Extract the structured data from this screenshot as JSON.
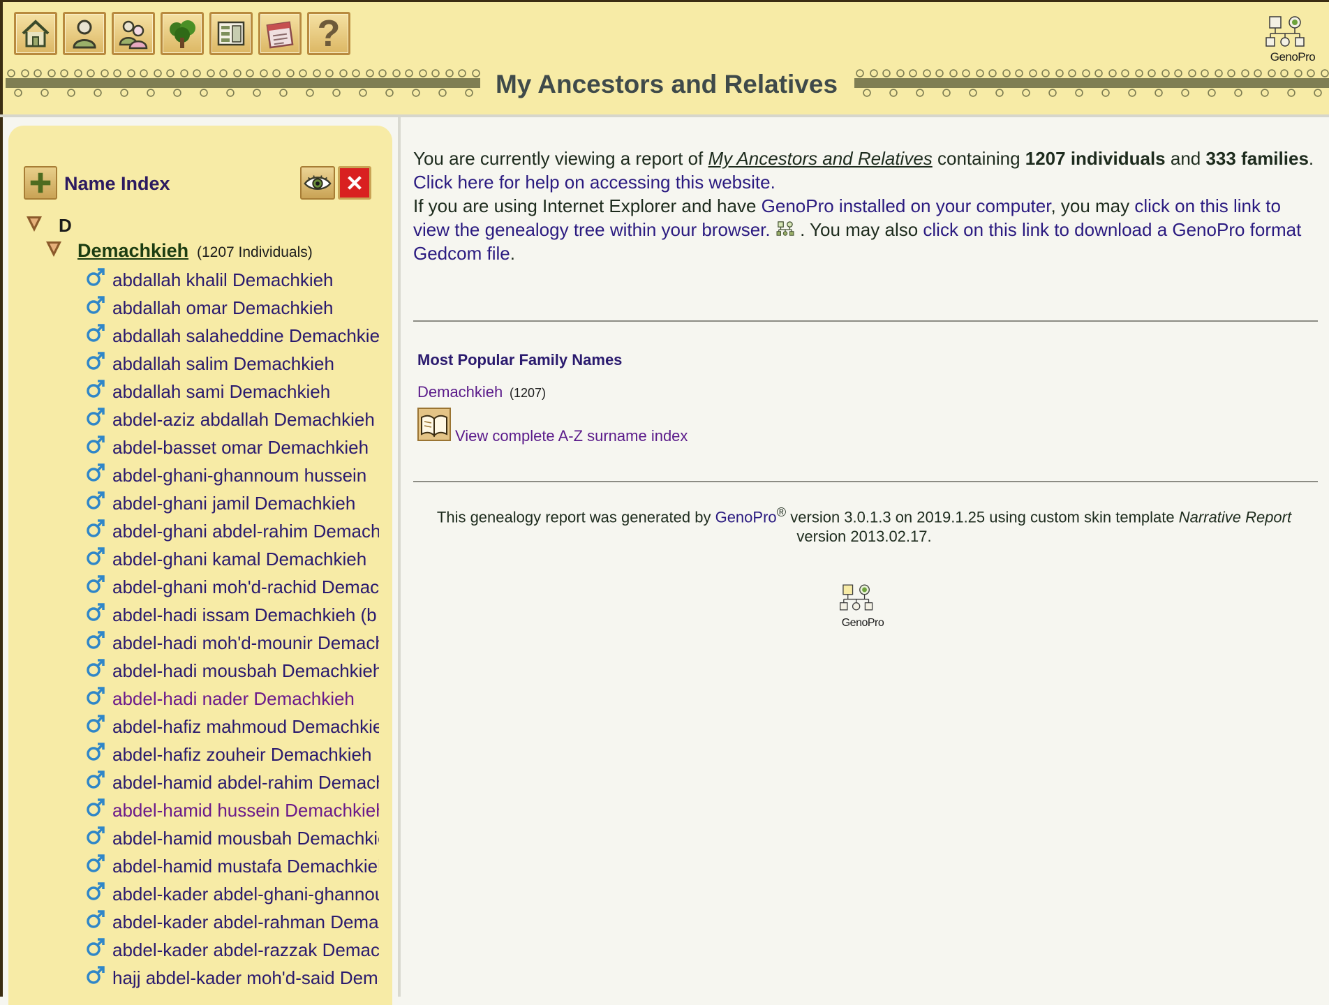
{
  "toolbar": {
    "buttons": [
      {
        "name": "home-button",
        "icon": "house-icon"
      },
      {
        "name": "individuals-button",
        "icon": "person-icon"
      },
      {
        "name": "families-button",
        "icon": "couple-icon"
      },
      {
        "name": "tree-button",
        "icon": "tree-icon"
      },
      {
        "name": "chart-button",
        "icon": "chart-icon"
      },
      {
        "name": "calendar-button",
        "icon": "calendar-icon"
      },
      {
        "name": "help-button",
        "icon": "question-icon",
        "label": "?"
      }
    ]
  },
  "header": {
    "title": "My Ancestors and Relatives",
    "logo_text": "GenoPro"
  },
  "sidebar": {
    "title": "Name Index",
    "letter": "D",
    "surname": "Demachkieh",
    "surname_count": "(1207 Individuals)",
    "people": [
      "abdallah khalil Demachkieh",
      "abdallah omar Demachkieh",
      "abdallah salaheddine Demachkieh",
      "abdallah salim Demachkieh",
      "abdallah sami Demachkieh",
      "abdel-aziz abdallah Demachkieh",
      "abdel-basset omar Demachkieh",
      "abdel-ghani-ghannoum hussein",
      "abdel-ghani  jamil Demachkieh",
      "abdel-ghani abdel-rahim Demachkieh",
      "abdel-ghani kamal Demachkieh",
      "abdel-ghani moh'd-rachid Demachkieh",
      "abdel-hadi issam Demachkieh (b",
      "abdel-hadi moh'd-mounir Demachkieh",
      "abdel-hadi mousbah Demachkieh",
      "abdel-hadi nader Demachkieh",
      "abdel-hafiz mahmoud Demachkieh",
      "abdel-hafiz zouheir Demachkieh",
      "abdel-hamid abdel-rahim Demachkieh",
      "abdel-hamid hussein Demachkieh",
      "abdel-hamid mousbah Demachkieh",
      "abdel-hamid mustafa Demachkieh",
      "abdel-kader abdel-ghani-ghannoum",
      "abdel-kader abdel-rahman Demachkieh",
      "abdel-kader abdel-razzak Demachkieh",
      "hajj abdel-kader moh'd-said Demachkieh"
    ],
    "visited": [
      15,
      19
    ]
  },
  "main": {
    "intro1_a": "You are currently viewing a report of ",
    "report_title": "My Ancestors and Relatives",
    "intro1_b": " containing ",
    "individuals": "1207 individuals",
    "and": " and ",
    "families": "333 families",
    "period": ". ",
    "help_link": "Click here for help on accessing this website.",
    "intro2_a": "If you are using Internet Explorer and have ",
    "genopro_link": "GenoPro installed on your computer",
    "intro2_b": ", you may ",
    "browser_link": "click on this link to view the genealogy tree within your browser.",
    "intro2_c": " . You may also ",
    "gedcom_link": "click on this link to download a GenoPro format Gedcom file",
    "intro2_d": ".",
    "popular_heading": "Most Popular Family Names",
    "popular_name": "Demachkieh",
    "popular_count": "(1207)",
    "az_link": "View complete A-Z surname index",
    "footer_a": "This genealogy report was generated by ",
    "footer_gp": "GenoPro",
    "footer_reg": "®",
    "footer_b": " version 3.0.1.3 on 2019.1.25 using custom skin template ",
    "footer_skin": "Narrative Report",
    "footer_c": " version 2013.02.17.",
    "logo_text": "GenoPro"
  }
}
